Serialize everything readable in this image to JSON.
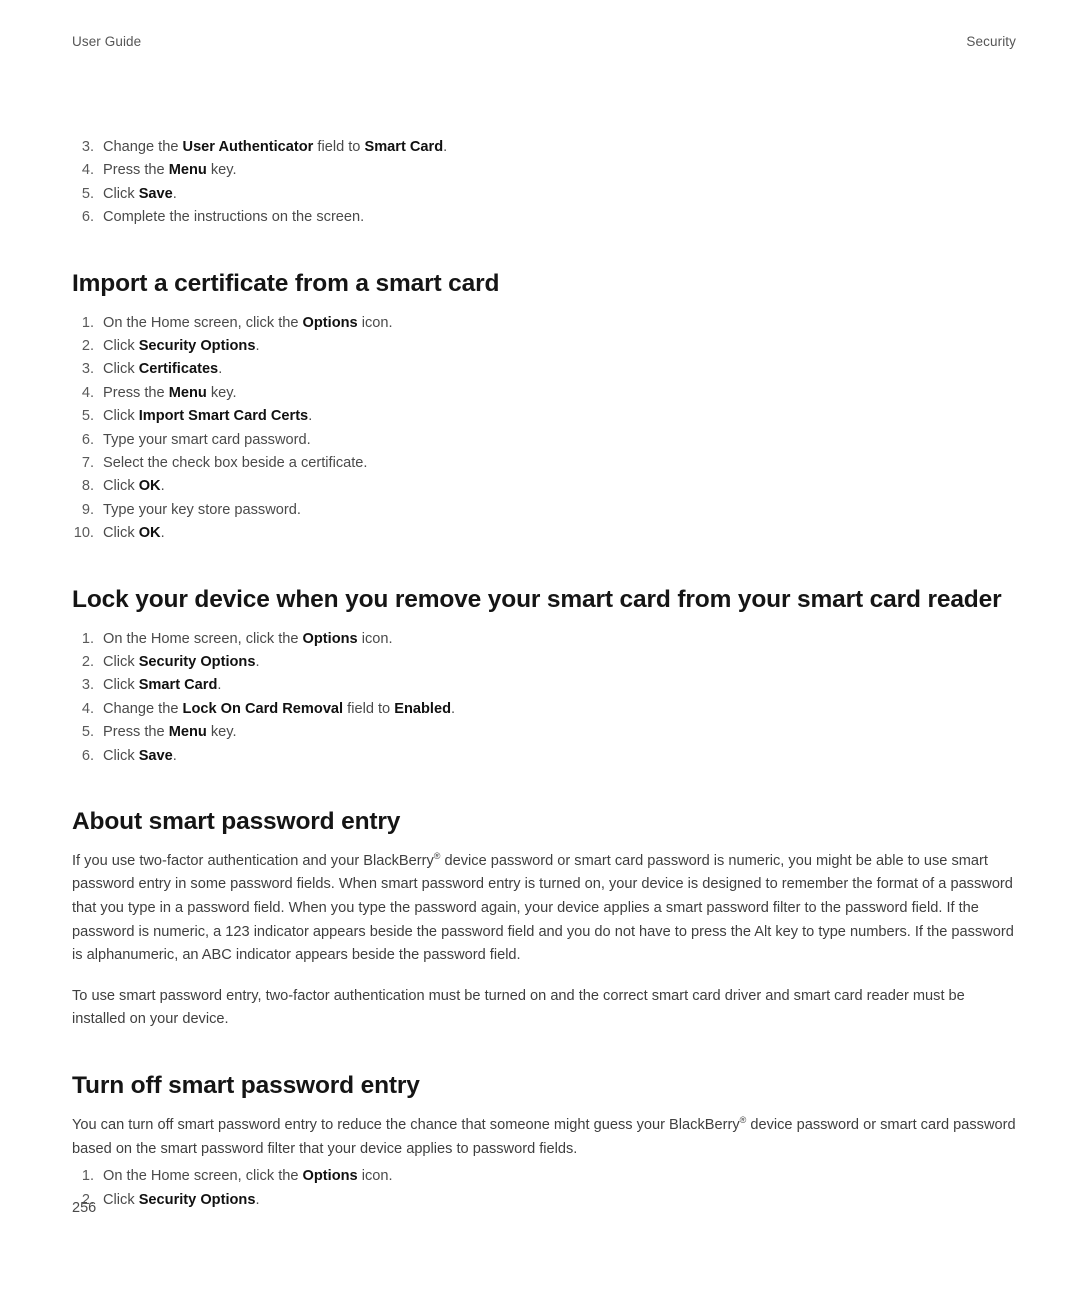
{
  "header": {
    "left": "User Guide",
    "right": "Security"
  },
  "page_number": "256",
  "blocks": [
    {
      "type": "list",
      "name": "steps-list-continued",
      "items": [
        {
          "num": "3.",
          "html": "Change the <b>User Authenticator</b> field to <b>Smart Card</b>."
        },
        {
          "num": "4.",
          "html": "Press the <b>Menu</b> key."
        },
        {
          "num": "5.",
          "html": "Click <b>Save</b>."
        },
        {
          "num": "6.",
          "html": "Complete the instructions on the screen."
        }
      ]
    },
    {
      "type": "heading",
      "name": "heading-import-certificate",
      "text": "Import a certificate from a smart card"
    },
    {
      "type": "list",
      "name": "steps-list-import-certificate",
      "items": [
        {
          "num": "1.",
          "html": "On the Home screen, click the <b>Options</b> icon."
        },
        {
          "num": "2.",
          "html": "Click <b>Security Options</b>."
        },
        {
          "num": "3.",
          "html": "Click <b>Certificates</b>."
        },
        {
          "num": "4.",
          "html": "Press the <b>Menu</b> key."
        },
        {
          "num": "5.",
          "html": "Click <b>Import Smart Card Certs</b>."
        },
        {
          "num": "6.",
          "html": "Type your smart card password."
        },
        {
          "num": "7.",
          "html": "Select the check box beside a certificate."
        },
        {
          "num": "8.",
          "html": "Click <b>OK</b>."
        },
        {
          "num": "9.",
          "html": "Type your key store password."
        },
        {
          "num": "10.",
          "html": "Click <b>OK</b>."
        }
      ]
    },
    {
      "type": "heading",
      "name": "heading-lock-device-on-card-removal",
      "text": "Lock your device when you remove your smart card from your smart card reader"
    },
    {
      "type": "list",
      "name": "steps-list-lock-device",
      "items": [
        {
          "num": "1.",
          "html": "On the Home screen, click the <b>Options</b> icon."
        },
        {
          "num": "2.",
          "html": "Click <b>Security Options</b>."
        },
        {
          "num": "3.",
          "html": "Click <b>Smart Card</b>."
        },
        {
          "num": "4.",
          "html": "Change the <b>Lock On Card Removal</b> field to <b>Enabled</b>."
        },
        {
          "num": "5.",
          "html": "Press the <b>Menu</b> key."
        },
        {
          "num": "6.",
          "html": "Click <b>Save</b>."
        }
      ]
    },
    {
      "type": "heading",
      "name": "heading-about-smart-password-entry",
      "text": "About smart password entry"
    },
    {
      "type": "paragraphs",
      "name": "paragraphs-about-smart-password-entry",
      "items": [
        "If you use two-factor authentication and your BlackBerry<sup class=\"reg\">®</sup> device password or smart card password is numeric, you might be able to use smart password entry in some password fields. When smart password entry is turned on, your device is designed to remember the format of a password that you type in a password field. When you type the password again, your device applies a smart password filter to the password field. If the password is numeric, a 123 indicator appears beside the password field and you do not have to press the Alt key to type numbers. If the password is alphanumeric, an ABC indicator appears beside the password field.",
        "To use smart password entry, two-factor authentication must be turned on and the correct smart card driver and smart card reader must be installed on your device."
      ]
    },
    {
      "type": "heading",
      "name": "heading-turn-off-smart-password-entry",
      "text": "Turn off smart password entry"
    },
    {
      "type": "paragraphs",
      "name": "paragraphs-turn-off-smart-password-entry",
      "items": [
        "You can turn off smart password entry to reduce the chance that someone might guess your BlackBerry<sup class=\"reg\">®</sup> device password or smart card password based on the smart password filter that your device applies to password fields."
      ]
    },
    {
      "type": "list",
      "name": "steps-list-turn-off-smart-password-entry",
      "items": [
        {
          "num": "1.",
          "html": "On the Home screen, click the <b>Options</b> icon."
        },
        {
          "num": "2.",
          "html": "Click <b>Security Options</b>."
        }
      ]
    }
  ]
}
